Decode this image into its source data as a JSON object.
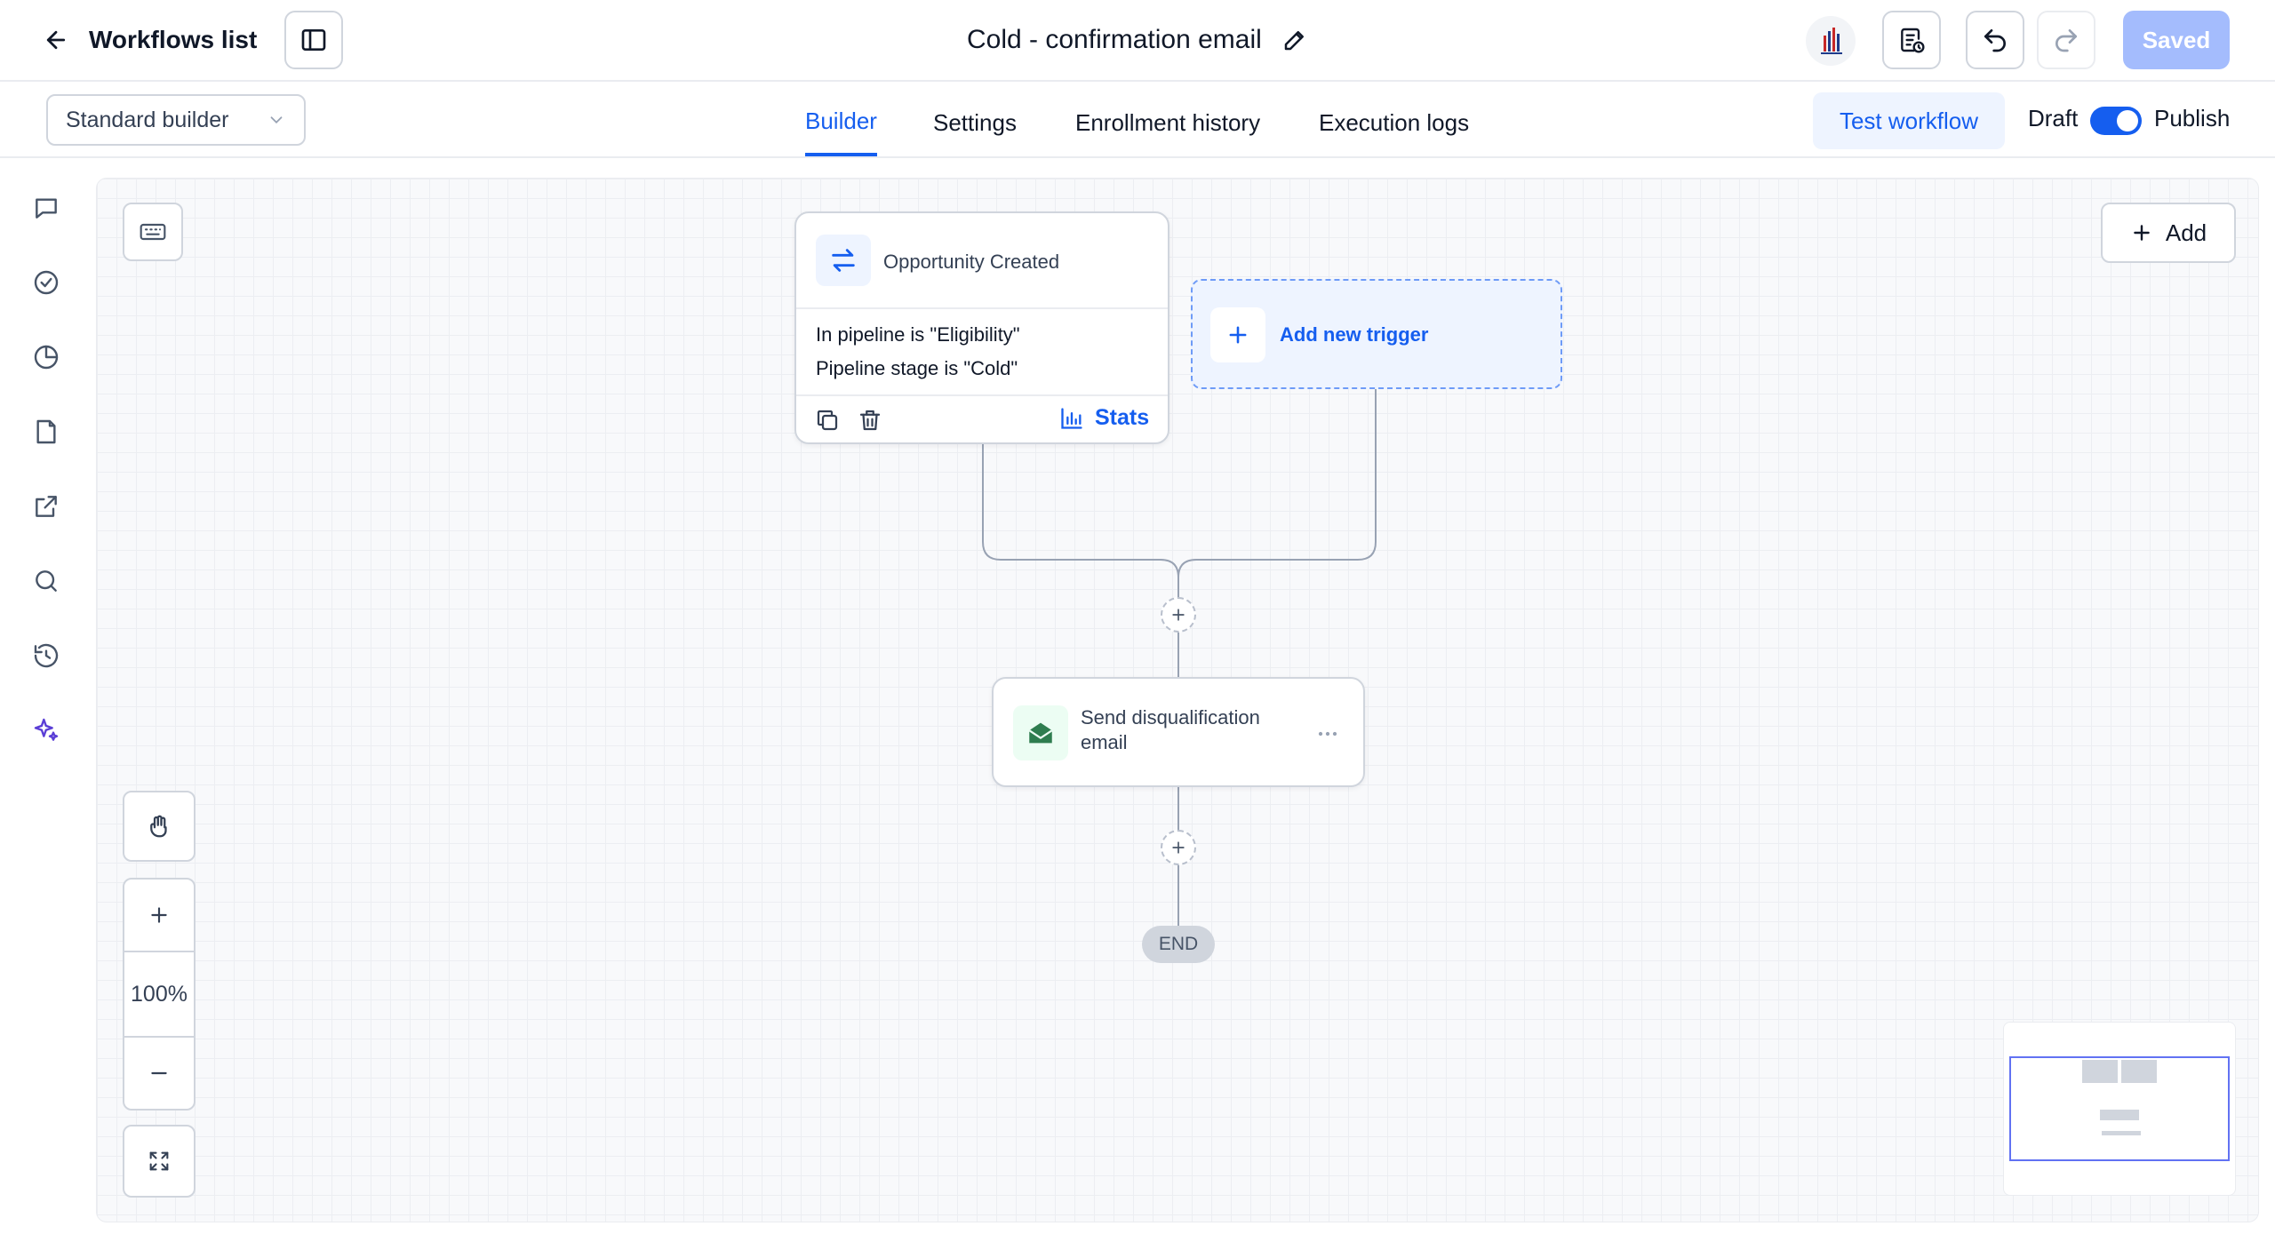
{
  "header": {
    "back_label": "Workflows list",
    "workflow_title": "Cold - confirmation email",
    "saved_label": "Saved"
  },
  "tabbar": {
    "builder_mode": "Standard builder",
    "tabs": [
      {
        "label": "Builder",
        "active": true
      },
      {
        "label": "Settings",
        "active": false
      },
      {
        "label": "Enrollment history",
        "active": false
      },
      {
        "label": "Execution logs",
        "active": false
      }
    ],
    "test_label": "Test workflow",
    "draft_label": "Draft",
    "publish_label": "Publish",
    "publish_on": true
  },
  "rail": {
    "icons": [
      "chat-icon",
      "check-circle-icon",
      "pie-chart-icon",
      "file-icon",
      "external-link-icon",
      "search-icon",
      "history-icon",
      "sparkles-icon"
    ]
  },
  "canvas": {
    "add_label": "Add",
    "zoom": "100%",
    "trigger": {
      "title": "Opportunity Created",
      "conditions": [
        "In pipeline is \"Eligibility\"",
        "Pipeline stage is \"Cold\""
      ],
      "stats_label": "Stats"
    },
    "add_trigger_label": "Add new trigger",
    "action": {
      "title": "Send disqualification email"
    },
    "end_label": "END"
  },
  "colors": {
    "accent": "#155eef",
    "saved_button": "#a4bcfd",
    "email_icon": "#2e7d4f"
  }
}
